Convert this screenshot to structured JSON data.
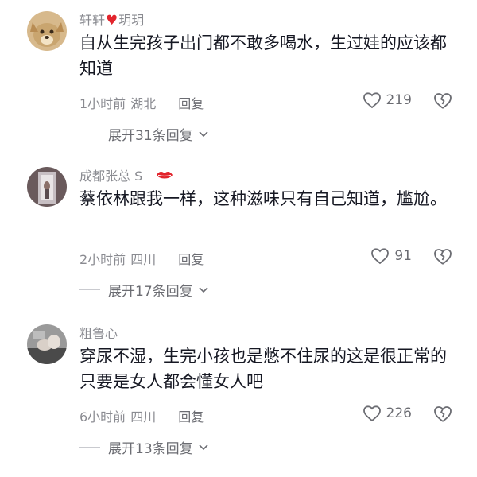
{
  "comments": [
    {
      "username_a": "轩轩",
      "username_b": "玥玥",
      "badge_icon": "heart-icon",
      "text": "自从生完孩子出门都不敢多喝水，生过娃的应该都知道",
      "time": "1小时前",
      "location": "湖北",
      "reply_label": "回复",
      "likes": "219",
      "expand_label": "展开31条回复"
    },
    {
      "username": "成都张总 S",
      "badge_icon": "lips-icon",
      "text": "蔡依林跟我一样，这种滋味只有自己知道，尴尬。",
      "time": "2小时前",
      "location": "四川",
      "reply_label": "回复",
      "likes": "91",
      "expand_label": "展开17条回复"
    },
    {
      "username": "粗鲁心",
      "text": "穿尿不湿，生完小孩也是憋不住尿的这是很正常的只要是女人都会懂女人吧",
      "time": "6小时前",
      "location": "四川",
      "reply_label": "回复",
      "likes": "226",
      "expand_label": "展开13条回复"
    }
  ],
  "colors": {
    "text": "#161823",
    "muted": "#8a8b91",
    "accent": "#e2242c"
  }
}
